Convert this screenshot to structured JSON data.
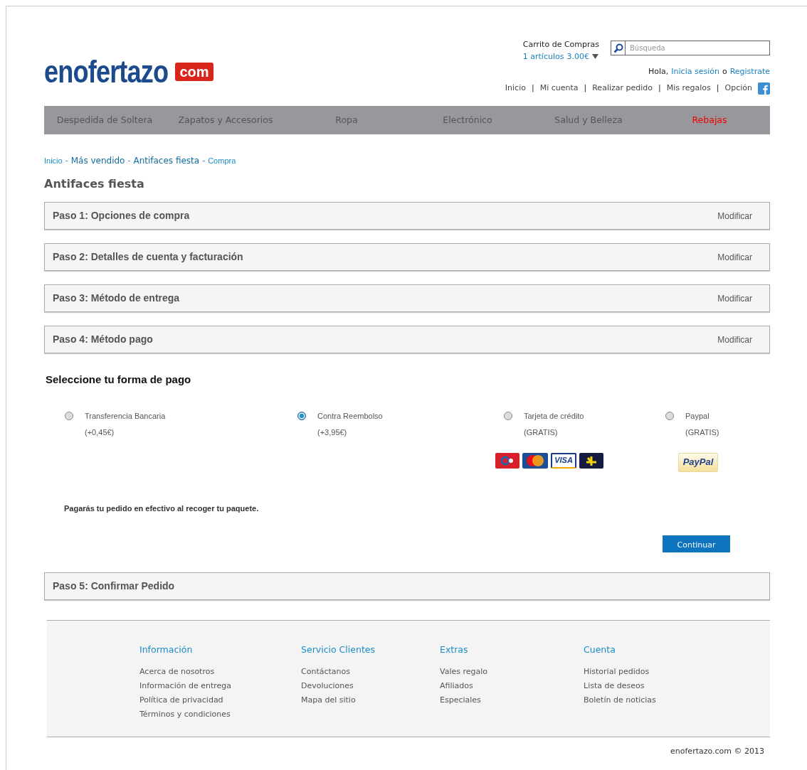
{
  "logo": {
    "name": "enofertazo",
    "tag": "com"
  },
  "cart": {
    "title": "Carrito de Compras",
    "count": "1 artículos",
    "total": "3.00€"
  },
  "search": {
    "placeholder": "Búsqueda"
  },
  "greeting": {
    "hello": "Hola,",
    "login": "Inicia sesión",
    "or": "o",
    "register": "Registrate"
  },
  "top_links": [
    "Inicio",
    "Mi cuenta",
    "Realizar pedido",
    "Mis regalos",
    "Opción"
  ],
  "top_links_separator": "|",
  "breadcrumb_separator": "-",
  "nav": [
    {
      "label": "Despedida de Soltera",
      "highlight": false
    },
    {
      "label": "Zapatos y Accesorios",
      "highlight": false
    },
    {
      "label": "Ropa",
      "highlight": false
    },
    {
      "label": "Electrónico",
      "highlight": false
    },
    {
      "label": "Salud y Belleza",
      "highlight": false
    },
    {
      "label": "Rebajas",
      "highlight": true
    }
  ],
  "breadcrumb": [
    {
      "label": "Inicio",
      "bold": false
    },
    {
      "label": "Más vendido",
      "bold": true
    },
    {
      "label": "Antifaces fiesta",
      "bold": true
    },
    {
      "label": "Compra",
      "bold": false
    }
  ],
  "page_title": "Antifaces fiesta",
  "steps": [
    {
      "title": "Paso 1: Opciones de compra",
      "action": "Modificar"
    },
    {
      "title": "Paso 2: Detalles de cuenta y facturación",
      "action": "Modificar"
    },
    {
      "title": "Paso 3: Método de entrega",
      "action": "Modificar"
    },
    {
      "title": "Paso 4: Método pago",
      "action": "Modificar"
    }
  ],
  "payment": {
    "heading": "Seleccione tu forma de pago",
    "methods": [
      {
        "label": "Transferencia Bancaria",
        "price": "(+0,45€)",
        "selected": false
      },
      {
        "label": "Contra Reembolso",
        "price": "(+3,95€)",
        "selected": true
      },
      {
        "label": "Tarjeta de crédito",
        "price": "(GRATIS)",
        "selected": false,
        "logos": [
          {
            "kind": "six"
          },
          {
            "kind": "mastercard"
          },
          {
            "kind": "visa",
            "label": "VISA"
          },
          {
            "kind": "fourb"
          }
        ]
      },
      {
        "label": "Paypal",
        "price": "(GRATIS)",
        "selected": false,
        "logos": [
          {
            "kind": "paypal",
            "label": "PayPal"
          }
        ]
      }
    ],
    "note": "Pagarás tu pedido en efectivo al recoger tu paquete.",
    "button": "Continuar"
  },
  "final_step": {
    "title": "Paso 5: Confirmar Pedido"
  },
  "footer": {
    "columns": [
      {
        "heading": "Información",
        "links": [
          "Acerca de nosotros",
          "Información de entrega",
          "Política de privacidad",
          "Términos y condiciones"
        ]
      },
      {
        "heading": "Servicio Clientes",
        "links": [
          "Contáctanos",
          "Devoluciones",
          "Mapa del sitio"
        ]
      },
      {
        "heading": "Extras",
        "links": [
          "Vales regalo",
          "Afiliados",
          "Especiales"
        ]
      },
      {
        "heading": "Cuenta",
        "links": [
          "Historial pedidos",
          "Lista de deseos",
          "Boletín de noticias"
        ]
      }
    ],
    "copyright": "enofertazo.com © 2013"
  }
}
